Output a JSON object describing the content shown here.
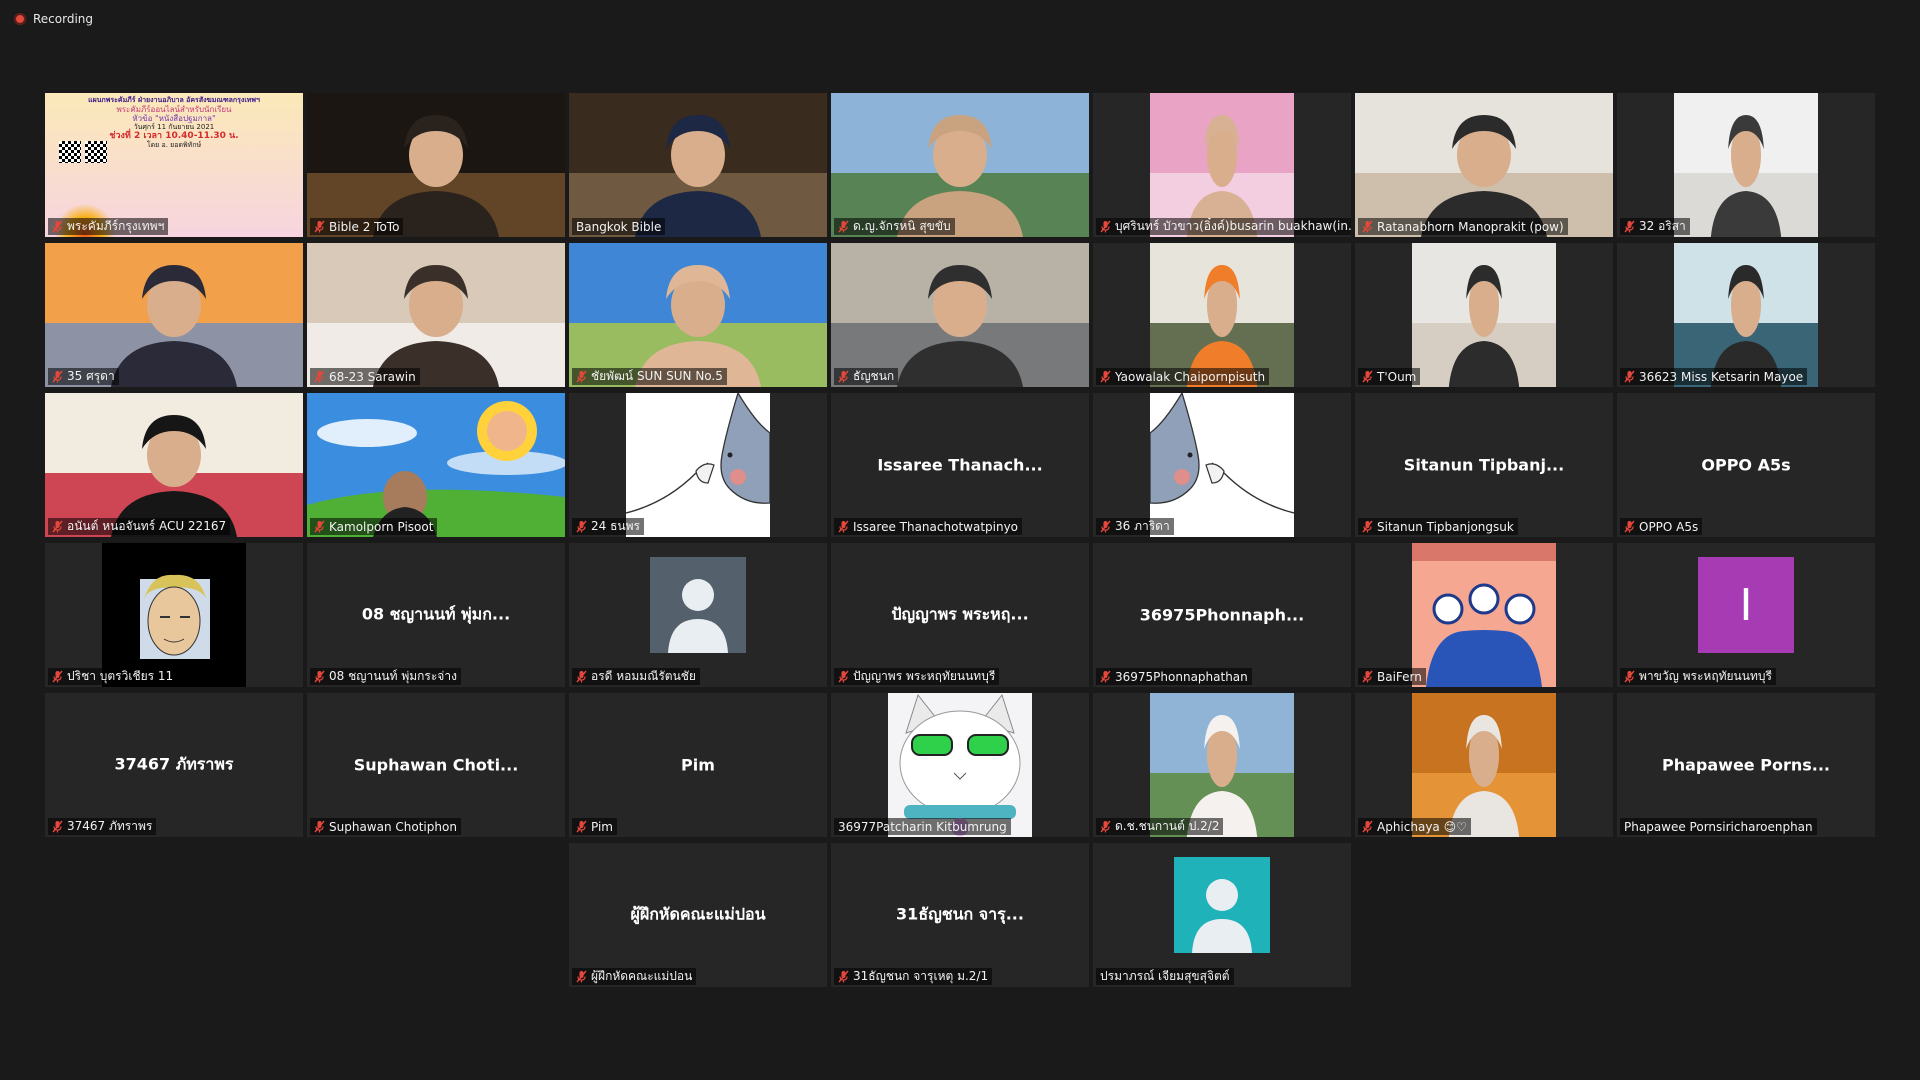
{
  "recording_label": "Recording",
  "colors": {
    "muted_mic": "#e5473b",
    "active_speaker": "#c9d84a",
    "recording": "#e24a3b"
  },
  "tiles": [
    {
      "label": "พระคัมภีร์กรุงเทพฯ",
      "muted": true,
      "kind": "poster",
      "poster": {
        "line1": "แผนกพระคัมภีร์ ฝ่ายงานอภิบาล อัครสังฆมณฑลกรุงเทพฯ",
        "line2": "พระคัมภีร์ออนไลน์สำหรับนักเรียน",
        "line3": "หัวข้อ \"หนังสือปฐมกาล\"",
        "line4": "วันศุกร์ 11 กันยายน 2021",
        "line5": "ช่วงที่ 2 เวลา 10.40-11.30 น.",
        "line6": "โดย อ. ยอดพิทักษ์"
      }
    },
    {
      "label": "Bible 2 ToTo",
      "muted": true,
      "kind": "scene",
      "palette": [
        "#1b1612",
        "#6e4e2c",
        "#2a221c"
      ]
    },
    {
      "label": "Bangkok Bible",
      "muted": false,
      "active": true,
      "kind": "scene",
      "palette": [
        "#3a2b1f",
        "#7a6248",
        "#1d2844"
      ]
    },
    {
      "label": "ด.ญ.จักรหนิ สุขขับ",
      "muted": true,
      "kind": "scene",
      "palette": [
        "#8db4d8",
        "#4f7a3e",
        "#c9a27f"
      ]
    },
    {
      "label": "บุศรินทร์ บัวขาว(อิ๋งค์)busarin buakhaw(in...",
      "muted": true,
      "kind": "boxscene",
      "palette": [
        "#e9a3c5",
        "#f4d5e4",
        "#d8b195"
      ]
    },
    {
      "label": "Ratanabhorn Manoprakit (pow)",
      "muted": true,
      "kind": "scene",
      "palette": [
        "#e6e2dc",
        "#c9b7a3",
        "#2b2b2b"
      ]
    },
    {
      "label": "32 อริสา",
      "muted": true,
      "kind": "boxscene",
      "palette": [
        "#f0f0f0",
        "#d8d6d2",
        "#3a3a3a"
      ]
    },
    {
      "label": "35 ศรุดา",
      "muted": true,
      "kind": "scene",
      "palette": [
        "#f3a04a",
        "#7a8fb5",
        "#2a2a38"
      ]
    },
    {
      "label": "68-23 Sarawin",
      "muted": true,
      "kind": "scene",
      "palette": [
        "#d9c9b8",
        "#f5f1ee",
        "#3b3029"
      ]
    },
    {
      "label": "ชัยพัฒน์ SUN SUN No.5",
      "muted": true,
      "kind": "scene",
      "palette": [
        "#3f86d6",
        "#a8c64a",
        "#e0b796"
      ]
    },
    {
      "label": "ธัญชนก",
      "muted": true,
      "kind": "scene",
      "palette": [
        "#b8b2a6",
        "#6b6e72",
        "#2f2f2f"
      ]
    },
    {
      "label": "Yaowalak Chaipornpisuth",
      "muted": true,
      "kind": "boxscene",
      "palette": [
        "#e7e4dc",
        "#4c5b3a",
        "#f07d2a"
      ]
    },
    {
      "label": "T'Oum",
      "muted": true,
      "kind": "boxscene",
      "palette": [
        "#e8e6e2",
        "#d4c9bd",
        "#2c2c2c"
      ]
    },
    {
      "label": "36623 Miss Ketsarin Mayoe",
      "muted": true,
      "kind": "boxscene",
      "palette": [
        "#cfe2e8",
        "#1f4f63",
        "#2a2a2a"
      ]
    },
    {
      "label": "อนันต์ หนอจันทร์ ACU 22167",
      "muted": true,
      "kind": "scene",
      "palette": [
        "#f1ebe0",
        "#c8283a",
        "#161616"
      ]
    },
    {
      "label": "Kamolporn Pisoot",
      "muted": true,
      "kind": "sky"
    },
    {
      "label": "24 ธนพร",
      "muted": true,
      "kind": "sketch",
      "flip": false
    },
    {
      "label": "Issaree Thanachotwatpinyo",
      "muted": true,
      "kind": "name",
      "name": "Issaree  Thanach..."
    },
    {
      "label": "36 ภาริดา",
      "muted": true,
      "kind": "sketch",
      "flip": true
    },
    {
      "label": "Sitanun Tipbanjongsuk",
      "muted": true,
      "kind": "name",
      "name": "Sitanun  Tipbanj..."
    },
    {
      "label": "OPPO A5s",
      "muted": true,
      "kind": "name",
      "name": "OPPO A5s"
    },
    {
      "label": "ปริชา บุตรวิเชียร  11",
      "muted": true,
      "kind": "cartoon"
    },
    {
      "label": "08 ชญานนท์ พุ่มกระจ่าง",
      "muted": true,
      "kind": "name",
      "name": "08 ชญานนท์ พุ่มก..."
    },
    {
      "label": "อรดี หอมมณีรัตนชัย",
      "muted": true,
      "kind": "avatar",
      "avatar_bg": "#54606b"
    },
    {
      "label": "ปัญญาพร พระหฤทัยนนทบุรี",
      "muted": true,
      "kind": "name",
      "name": "ปัญญาพร พระหฤ..."
    },
    {
      "label": "36975Phonnaphathan",
      "muted": true,
      "kind": "name",
      "name": "36975Phonnaph..."
    },
    {
      "label": "BaiFern",
      "muted": true,
      "kind": "poster2"
    },
    {
      "label": "พาขวัญ พระหฤทัยนนทบุรี",
      "muted": true,
      "kind": "initial",
      "initial": "I"
    },
    {
      "label": "37467 ภัทราพร",
      "muted": true,
      "kind": "name",
      "name": "37467 ภัทราพร"
    },
    {
      "label": "Suphawan Chotiphon",
      "muted": true,
      "kind": "name",
      "name": "Suphawan  Choti..."
    },
    {
      "label": "Pim",
      "muted": true,
      "kind": "name",
      "name": "Pim"
    },
    {
      "label": "36977Patcharin Kitbumrung",
      "muted": false,
      "kind": "cat"
    },
    {
      "label": "ด.ช.ชนกานต์ ป.2/2",
      "muted": true,
      "kind": "boxscene",
      "palette": [
        "#8fb4d6",
        "#5e8a3e",
        "#f4f1ee"
      ]
    },
    {
      "label": "Aphichaya 😊♡",
      "muted": true,
      "kind": "boxscene",
      "palette": [
        "#c7731f",
        "#e99a3b",
        "#e9e5e0"
      ]
    },
    {
      "label": "Phapawee Pornsiricharoenphan",
      "muted": false,
      "kind": "name",
      "name": "Phapawee  Porns..."
    },
    {
      "label": "ผู้ฝึกหัดคณะแม่ปอน",
      "muted": true,
      "kind": "name",
      "name": "ผู้ฝึกหัดคณะแม่ปอน"
    },
    {
      "label": "31ธัญชนก    จารุเหตุ ม.2/1",
      "muted": true,
      "kind": "name",
      "name": "31ธัญชนก    จารุ..."
    },
    {
      "label": "ปรมาภรณ์ เจียมสุขสุจิตต์",
      "muted": false,
      "kind": "avatar",
      "avatar_bg": "#20b2b9"
    }
  ]
}
